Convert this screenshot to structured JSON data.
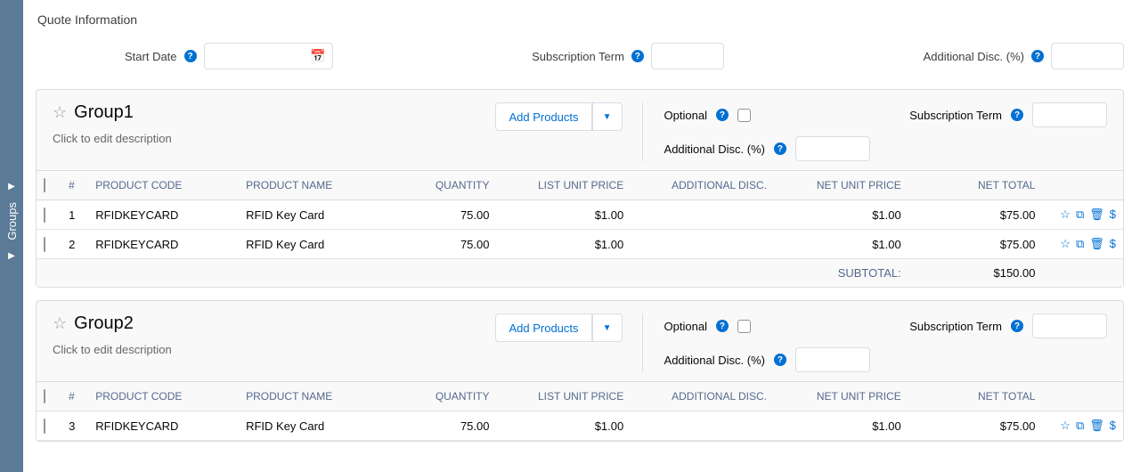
{
  "sideRail": {
    "label": "Groups"
  },
  "sectionTitle": "Quote Information",
  "quoteFields": {
    "startDate": {
      "label": "Start Date"
    },
    "subscriptionTerm": {
      "label": "Subscription Term"
    },
    "additionalDisc": {
      "label": "Additional Disc. (%)"
    }
  },
  "addProductsLabel": "Add Products",
  "groupFieldLabels": {
    "optional": "Optional",
    "subscriptionTerm": "Subscription Term",
    "additionalDisc": "Additional Disc. (%)"
  },
  "columns": {
    "num": "#",
    "code": "PRODUCT CODE",
    "name": "PRODUCT NAME",
    "qty": "QUANTITY",
    "list": "LIST UNIT PRICE",
    "disc": "ADDITIONAL DISC.",
    "net": "NET UNIT PRICE",
    "total": "NET TOTAL"
  },
  "subtotalLabel": "SUBTOTAL:",
  "groups": [
    {
      "title": "Group1",
      "desc": "Click to edit description",
      "rows": [
        {
          "n": "1",
          "code": "RFIDKEYCARD",
          "name": "RFID Key Card",
          "qty": "75.00",
          "list": "$1.00",
          "disc": "",
          "net": "$1.00",
          "total": "$75.00"
        },
        {
          "n": "2",
          "code": "RFIDKEYCARD",
          "name": "RFID Key Card",
          "qty": "75.00",
          "list": "$1.00",
          "disc": "",
          "net": "$1.00",
          "total": "$75.00"
        }
      ],
      "subtotal": "$150.00"
    },
    {
      "title": "Group2",
      "desc": "Click to edit description",
      "rows": [
        {
          "n": "3",
          "code": "RFIDKEYCARD",
          "name": "RFID Key Card",
          "qty": "75.00",
          "list": "$1.00",
          "disc": "",
          "net": "$1.00",
          "total": "$75.00"
        }
      ],
      "subtotal": ""
    }
  ]
}
